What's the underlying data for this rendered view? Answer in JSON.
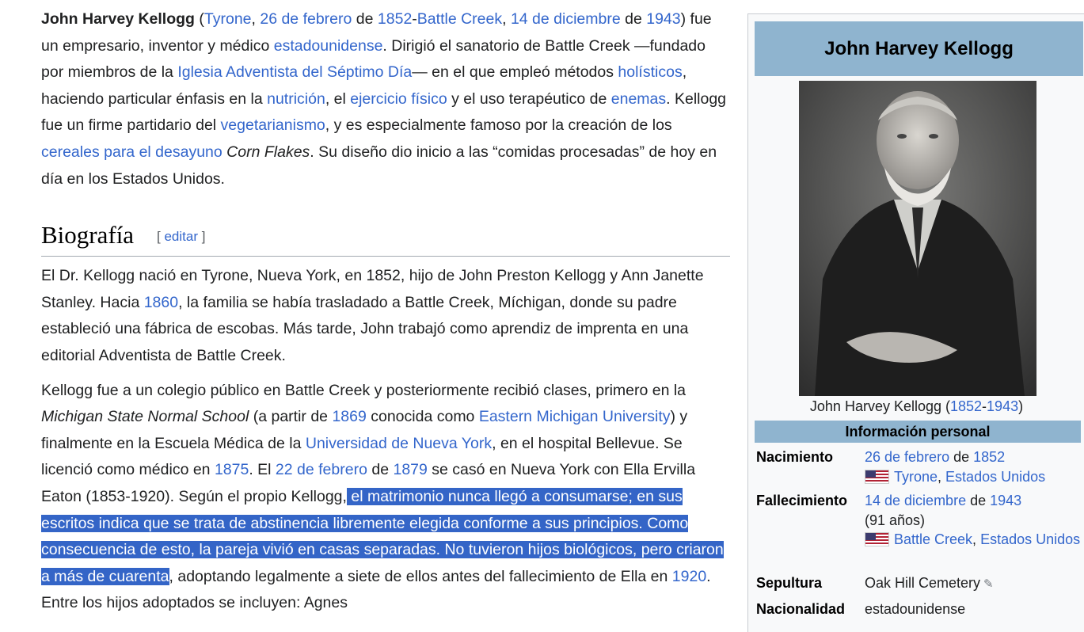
{
  "intro": {
    "name": "John Harvey Kellogg",
    "t1": " (",
    "birth_place": "Tyrone",
    "t2": ", ",
    "birth_date": "26 de febrero",
    "t3": " de ",
    "birth_year": "1852",
    "t4": "-",
    "death_place": "Battle Creek",
    "t5": ", ",
    "death_date": "14 de diciembre",
    "t6": " de ",
    "death_year": "1943",
    "t7": ") fue un empresario, inventor y médico ",
    "nationality_link": "estadounidense",
    "t8": ". Dirigió el sanatorio de Battle Creek —fundado por miembros de la ",
    "church_link": "Iglesia Adventista del Séptimo Día",
    "t9": "— en el que empleó métodos ",
    "holistic_link": "holísticos",
    "t10": ", haciendo particular énfasis en la ",
    "nutrition_link": "nutrición",
    "t11": ", el ",
    "exercise_link": "ejercicio físico",
    "t12": " y el uso terapéutico de ",
    "enema_link": "enemas",
    "t13": ". Kellogg fue un firme partidario del ",
    "veg_link": "vegetarianismo",
    "t14": ", y es especialmente famoso por la creación de los ",
    "cereal_link": "cereales para el desayuno",
    "t15": " ",
    "corn_flakes": "Corn Flakes",
    "t16": ". Su diseño dio inicio a las “comidas procesadas” de hoy en día en los Estados Unidos."
  },
  "section": {
    "heading": "Biografía",
    "edit_open": "[ ",
    "edit_link": "editar",
    "edit_close": " ]"
  },
  "bio1": {
    "t1": "El Dr. Kellogg nació en Tyrone, Nueva York, en 1852, hijo de John Preston Kellogg y Ann Janette Stanley. Hacia ",
    "year_link": "1860",
    "t2": ", la familia se había trasladado a Battle Creek, Míchigan, donde su padre estableció una fábrica de escobas. Más tarde, John trabajó como aprendiz de imprenta en una editorial Adventista de Battle Creek."
  },
  "bio2": {
    "t1": "Kellogg fue a un colegio público en Battle Creek y posteriormente recibió clases, primero en la ",
    "school": "Michigan State Normal School",
    "t2": " (a partir de ",
    "year1_link": "1869",
    "t3": " conocida como ",
    "emu_link": "Eastern Michigan University",
    "t4": ") y finalmente en la Escuela Médica de la ",
    "nyu_link": "Universidad de Nueva York",
    "t5": ", en el hospital Bellevue. Se licenció como médico en ",
    "year2_link": "1875",
    "t6": ". El ",
    "date_link": "22 de febrero",
    "t7": " de ",
    "year3_link": "1879",
    "t8": " se casó en Nueva York con Ella Ervilla Eaton (1853-1920). Según el propio Kellogg,",
    "highlight": " el matrimonio nunca llegó a consumarse; en sus escritos indica que se trata de abstinencia libremente elegida conforme a sus principios. Como consecuencia de esto, la pareja vivió en casas separadas. No tuvieron hijos biológicos, pero criaron a más de cuarenta",
    "t9": ", adoptando legalmente a siete de ellos antes del fallecimiento de Ella en ",
    "year4_link": "1920",
    "t10": ". Entre los hijos adoptados se incluyen: Agnes"
  },
  "infobox": {
    "title": "John Harvey Kellogg",
    "caption_name": "John Harvey Kellogg (",
    "caption_y1": "1852",
    "caption_dash": "-",
    "caption_y2": "1943",
    "caption_close": ")",
    "section": "Información personal",
    "birth_label": "Nacimiento",
    "birth_date": "26 de febrero",
    "birth_de": " de ",
    "birth_year": "1852",
    "birth_city": "Tyrone",
    "birth_sep": ", ",
    "birth_country": "Estados Unidos",
    "death_label": "Fallecimiento",
    "death_date": "14 de diciembre",
    "death_de": " de ",
    "death_year": "1943",
    "death_age": "(91 años)",
    "death_city": "Battle Creek",
    "death_sep": ", ",
    "death_country": "Estados Unidos",
    "burial_label": "Sepultura",
    "burial_value": "Oak Hill Cemetery",
    "nat_label": "Nacionalidad",
    "nat_value": "estadounidense",
    "pencil_icon": "pencil-icon",
    "flag_icon": "us-flag-icon"
  }
}
